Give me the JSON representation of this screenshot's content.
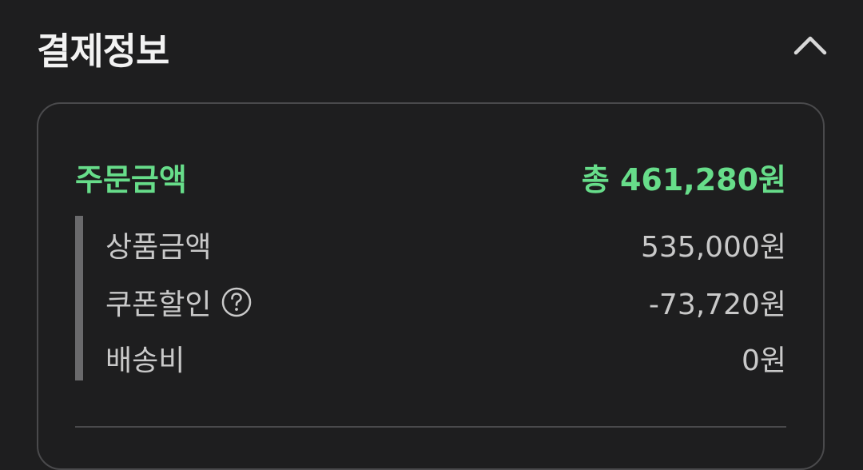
{
  "section": {
    "title": "결제정보",
    "collapse_icon": "chevron-up-icon"
  },
  "order": {
    "label": "주문금액",
    "total": "총 461,280원",
    "accent_color": "#67dd8a"
  },
  "details": {
    "product": {
      "label": "상품금액",
      "value": "535,000원"
    },
    "coupon": {
      "label": "쿠폰할인",
      "value": "-73,720원",
      "help_icon": "question-circle-icon"
    },
    "shipping": {
      "label": "배송비",
      "value": "0원"
    }
  }
}
